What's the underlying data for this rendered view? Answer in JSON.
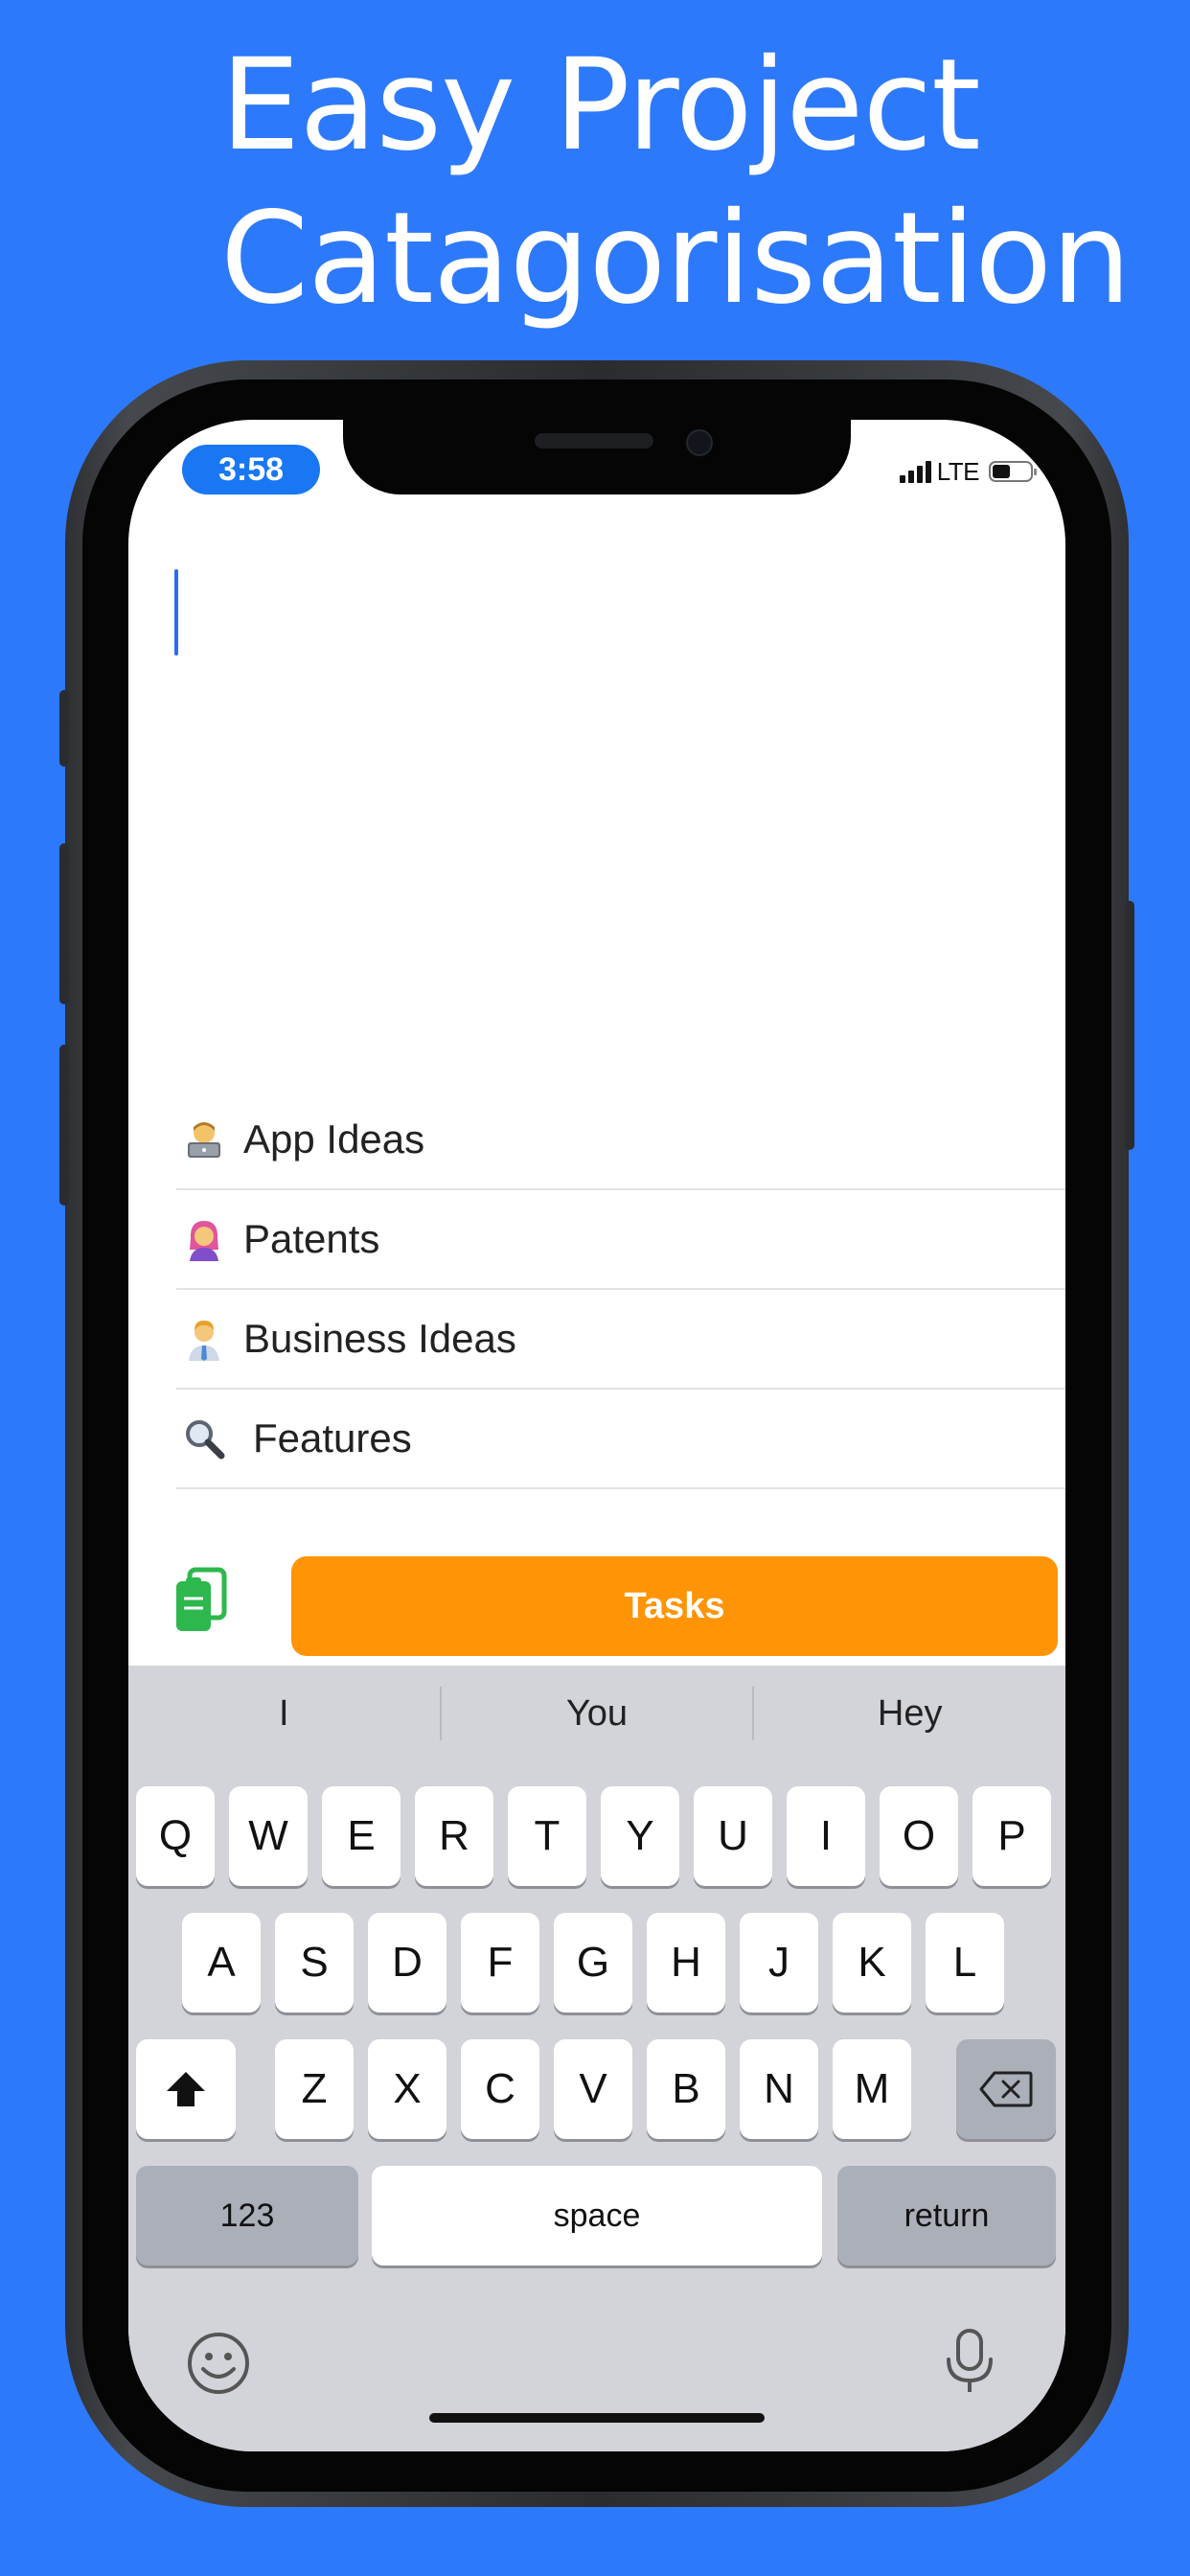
{
  "headline": [
    "Easy Project",
    "Catagorisation"
  ],
  "status_bar": {
    "time": "3:58",
    "network": "LTE"
  },
  "categories": [
    {
      "icon": "technologist-emoji-icon",
      "label": "App Ideas"
    },
    {
      "icon": "woman-pink-hair-emoji-icon",
      "label": "Patents"
    },
    {
      "icon": "man-office-worker-emoji-icon",
      "label": "Business Ideas"
    },
    {
      "icon": "magnifying-glass-emoji-icon",
      "label": "Features"
    }
  ],
  "toolbar": {
    "tasks_label": "Tasks",
    "clipboard_icon": "copy-clipboard-icon"
  },
  "keyboard": {
    "suggestions": [
      "I",
      "You",
      "Hey"
    ],
    "row1": [
      "Q",
      "W",
      "E",
      "R",
      "T",
      "Y",
      "U",
      "I",
      "O",
      "P"
    ],
    "row2": [
      "A",
      "S",
      "D",
      "F",
      "G",
      "H",
      "J",
      "K",
      "L"
    ],
    "row3": [
      "Z",
      "X",
      "C",
      "V",
      "B",
      "N",
      "M"
    ],
    "numbers_label": "123",
    "space_label": "space",
    "return_label": "return"
  },
  "colors": {
    "background": "#2d79fb",
    "tasks_button": "#ff9406",
    "caret": "#2c6cf6",
    "time_pill": "#1977f3"
  }
}
